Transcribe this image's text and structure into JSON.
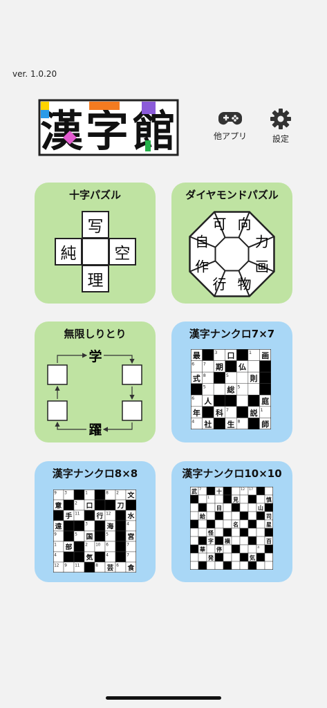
{
  "version": "ver. 1.0.20",
  "logo": {
    "chars": [
      "漢",
      "字",
      "館"
    ]
  },
  "header": {
    "other_apps_label": "他アプリ",
    "settings_label": "設定"
  },
  "cards": {
    "jujipuzzle": {
      "title": "十字パズル",
      "center": "",
      "top": "写",
      "left": "純",
      "right": "空",
      "bottom": "理"
    },
    "diamond": {
      "title": "ダイヤモンドパズル",
      "chars": [
        "可",
        "向",
        "力",
        "画",
        "物",
        "行",
        "作",
        "自"
      ]
    },
    "shiritori": {
      "title": "無限しりとり",
      "top": "学",
      "bottom": "躍"
    },
    "nankuro7": {
      "title": "漢字ナンクロ7×7",
      "grid": [
        [
          "最",
          "",
          "3",
          "口",
          "",
          "1",
          "画"
        ],
        [
          "6",
          "7",
          "期",
          "",
          "仏",
          "",
          "5"
        ],
        [
          "式",
          "8",
          "",
          "5",
          "",
          "則",
          ""
        ],
        [
          "",
          "5",
          "",
          "総",
          "5",
          "",
          "3"
        ],
        [
          "6",
          "人",
          "",
          "",
          "",
          "",
          "庭"
        ],
        [
          "年",
          "",
          "科",
          "7",
          "",
          "説",
          "1"
        ],
        [
          "4",
          "社",
          "",
          "生",
          "8",
          "",
          "師"
        ]
      ],
      "black": [
        [
          0,
          1
        ],
        [
          0,
          4
        ],
        [
          1,
          3
        ],
        [
          1,
          6
        ],
        [
          2,
          2
        ],
        [
          2,
          6
        ],
        [
          3,
          0
        ],
        [
          3,
          6
        ],
        [
          4,
          2
        ],
        [
          4,
          3
        ],
        [
          4,
          5
        ],
        [
          5,
          1
        ],
        [
          5,
          4
        ],
        [
          6,
          2
        ],
        [
          6,
          5
        ]
      ]
    },
    "nankuro8": {
      "title": "漢字ナンクロ8×8",
      "grid": [
        [
          "9",
          "3",
          "",
          "1",
          "",
          "8",
          "2",
          "文"
        ],
        [
          "意",
          "",
          "2",
          "口",
          "",
          "",
          "刀",
          ""
        ],
        [
          "",
          "手",
          "11",
          "",
          "行",
          "12",
          "",
          "水"
        ],
        [
          "遠",
          "",
          "",
          "3",
          "",
          "海",
          "",
          "4"
        ],
        [
          "9",
          "",
          "5",
          "国",
          "",
          "5",
          "",
          "宮"
        ],
        [
          "1",
          "部",
          "",
          "2",
          "10",
          "6",
          "",
          "7"
        ],
        [
          "4",
          "",
          "",
          "気",
          "",
          "4",
          "",
          "7"
        ],
        [
          "12",
          "9",
          "11",
          "",
          "8",
          "芸",
          "6",
          "食"
        ]
      ],
      "black": [
        [
          0,
          2
        ],
        [
          0,
          4
        ],
        [
          1,
          1
        ],
        [
          1,
          4
        ],
        [
          1,
          5
        ],
        [
          1,
          7
        ],
        [
          2,
          0
        ],
        [
          2,
          3
        ],
        [
          2,
          6
        ],
        [
          3,
          1
        ],
        [
          3,
          2
        ],
        [
          3,
          4
        ],
        [
          3,
          6
        ],
        [
          4,
          1
        ],
        [
          4,
          4
        ],
        [
          4,
          6
        ],
        [
          5,
          2
        ],
        [
          5,
          6
        ],
        [
          6,
          1
        ],
        [
          6,
          2
        ],
        [
          6,
          4
        ],
        [
          6,
          6
        ],
        [
          7,
          3
        ]
      ]
    },
    "nankuro10": {
      "title": "漢字ナンクロ10×10",
      "grid": [
        [
          "武",
          "7",
          "",
          "十",
          "",
          "",
          "12",
          "17",
          "",
          ""
        ],
        [
          "",
          "",
          "1",
          "",
          "",
          "見",
          "",
          "",
          "",
          "慎"
        ],
        [
          "",
          "14",
          "",
          "目",
          "",
          "20",
          "",
          "",
          "山",
          ""
        ],
        [
          "",
          "給",
          "",
          "",
          "",
          "",
          "",
          "",
          "",
          "司"
        ],
        [
          "日",
          "",
          "",
          "",
          "",
          "名",
          "",
          "",
          "",
          "星"
        ],
        [
          "",
          "",
          "怪",
          "",
          "",
          "",
          "",
          "",
          "",
          ""
        ],
        [
          "",
          "",
          "字",
          "",
          "横",
          "",
          "",
          "",
          "",
          "百"
        ],
        [
          "",
          "華",
          "",
          "停",
          "",
          "",
          "",
          "",
          "4",
          ""
        ],
        [
          "",
          "",
          "発",
          "",
          "",
          "",
          "",
          "気",
          "",
          ""
        ],
        [
          "",
          "",
          "",
          "",
          "",
          "",
          "",
          "",
          "",
          ""
        ]
      ],
      "black": [
        [
          0,
          2
        ],
        [
          0,
          4
        ],
        [
          0,
          8
        ],
        [
          1,
          0
        ],
        [
          1,
          4
        ],
        [
          1,
          7
        ],
        [
          2,
          1
        ],
        [
          2,
          5
        ],
        [
          2,
          9
        ],
        [
          3,
          3
        ],
        [
          3,
          6
        ],
        [
          3,
          8
        ],
        [
          4,
          0
        ],
        [
          4,
          2
        ],
        [
          4,
          7
        ],
        [
          5,
          4
        ],
        [
          5,
          6
        ],
        [
          5,
          9
        ],
        [
          6,
          1
        ],
        [
          6,
          3
        ],
        [
          6,
          7
        ],
        [
          7,
          0
        ],
        [
          7,
          5
        ],
        [
          7,
          9
        ],
        [
          8,
          3
        ],
        [
          8,
          6
        ],
        [
          8,
          8
        ],
        [
          9,
          1
        ],
        [
          9,
          4
        ],
        [
          9,
          7
        ]
      ]
    }
  },
  "colors": {
    "background": "#f2f2f2",
    "green_card": "#bfe3a2",
    "blue_card": "#a9d7f6"
  }
}
